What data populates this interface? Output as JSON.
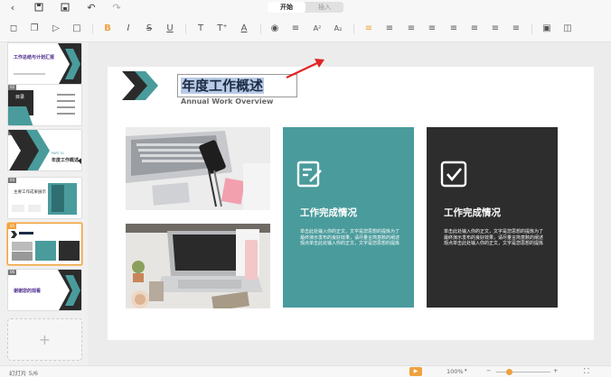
{
  "tabs": [
    {
      "label": "开始"
    },
    {
      "label": "插入"
    }
  ],
  "slide_panel": {
    "slides": [
      {
        "num": "",
        "title": "工作总结与计划汇报"
      },
      {
        "num": "02",
        "title": "目录"
      },
      {
        "num": "03",
        "part": "PART 01",
        "title": "年度工作概述"
      },
      {
        "num": "04",
        "title": "主要工作成果展示"
      },
      {
        "num": "05"
      },
      {
        "num": "06",
        "title": "谢谢您的观看"
      }
    ],
    "add_label": "+"
  },
  "slide": {
    "title": "年度工作概述",
    "subtitle": "Annual Work Overview",
    "cards": [
      {
        "title": "工作完成情况",
        "body": "单击此处输入你的正文，文字是您思想的提炼为了最终演示发布的良好效果，请尽量言简意赅的阐述观点单击此处输入你的正文，文字是您思想的提炼"
      },
      {
        "title": "工作完成情况",
        "body": "单击此处输入你的正文，文字是您思想的提炼为了最终演示发布的良好效果，请尽量言简意赅的阐述观点单击此处输入你的正文，文字是您思想的提炼"
      }
    ]
  },
  "status": {
    "slide_counter": "幻灯片 5/6",
    "zoom": "100%",
    "minus": "−",
    "plus": "+"
  },
  "colors": {
    "teal": "#4a9b9c",
    "dark": "#2d2d2d",
    "accent": "#f0a13c",
    "arrow": "#e02424"
  }
}
